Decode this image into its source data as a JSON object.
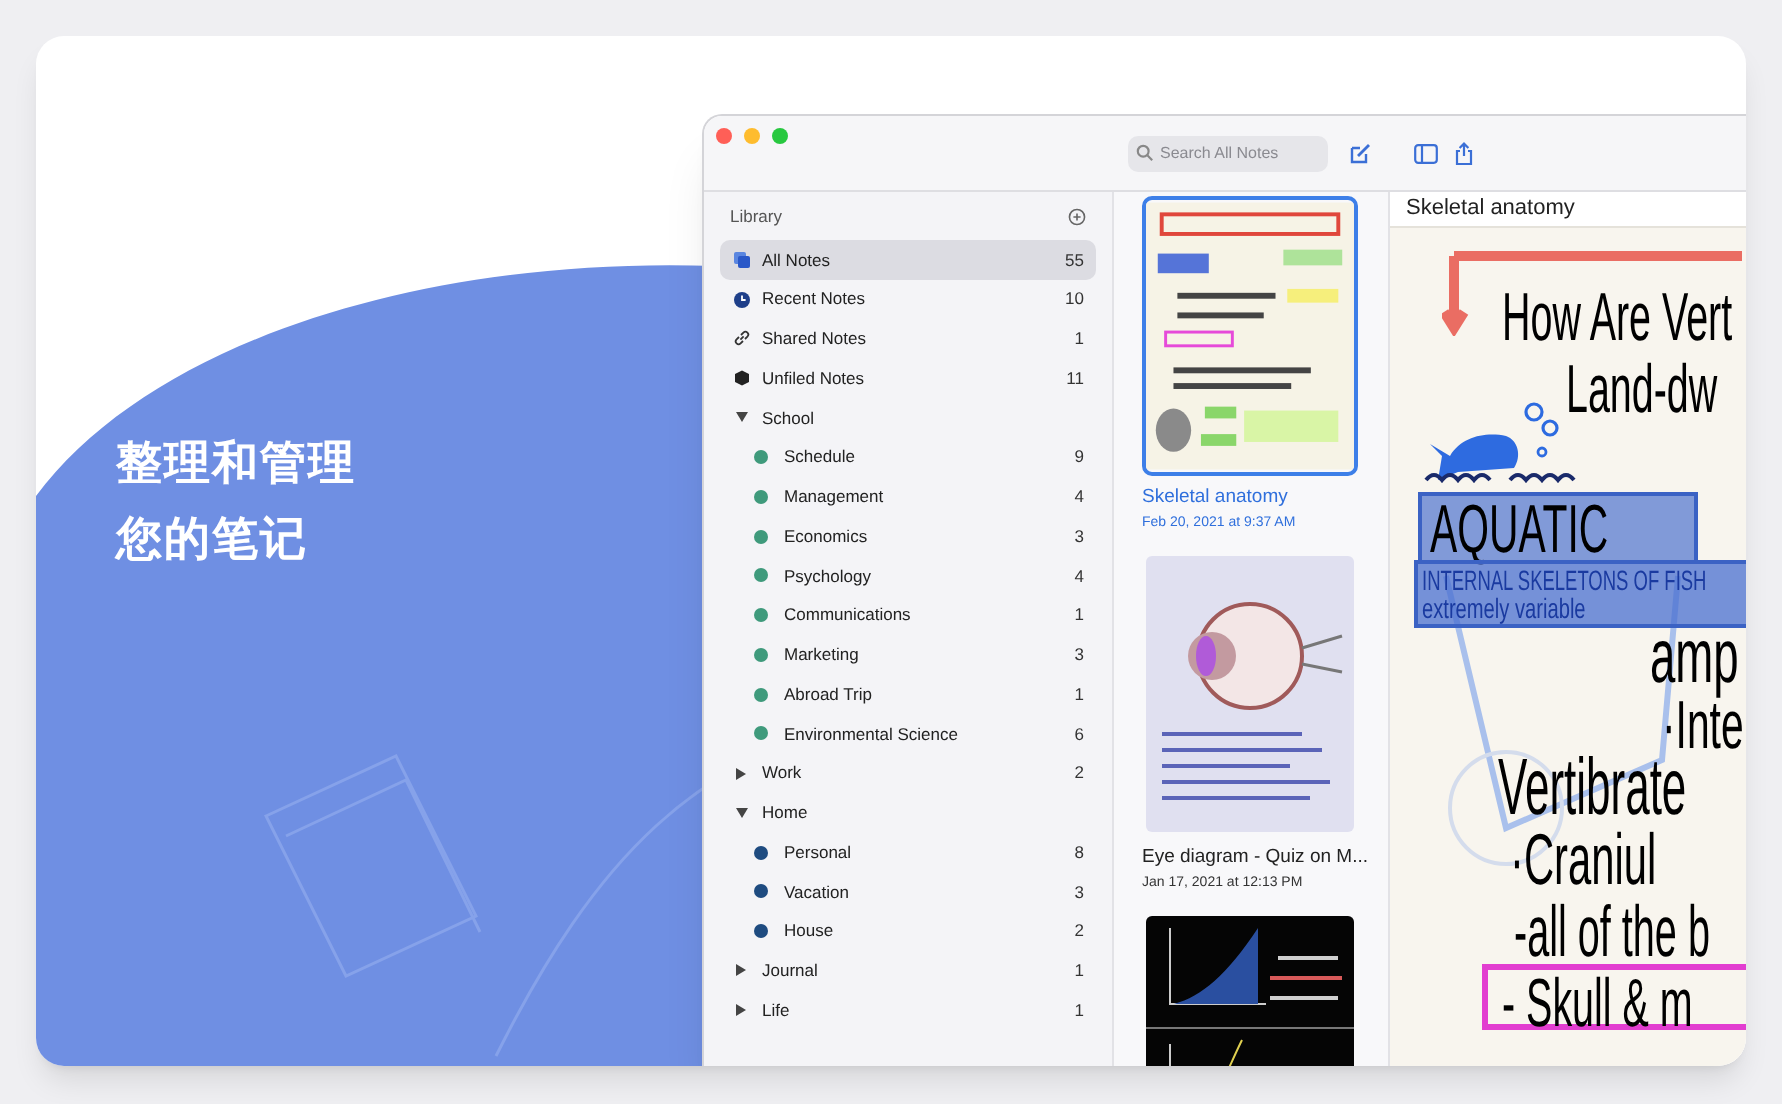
{
  "headline": [
    "整理和管理",
    "您的笔记"
  ],
  "toolbar": {
    "search": {
      "placeholder": "Search All Notes"
    }
  },
  "sidebar": {
    "header": "Library",
    "items": [
      {
        "kind": "smart",
        "label": "All Notes",
        "count": "55",
        "selected": true
      },
      {
        "kind": "smart",
        "label": "Recent Notes",
        "count": "10",
        "selected": false
      },
      {
        "kind": "smart",
        "label": "Shared Notes",
        "count": "1",
        "selected": false
      },
      {
        "kind": "smart",
        "label": "Unfiled Notes",
        "count": "11",
        "selected": false
      },
      {
        "kind": "folder",
        "label": "School",
        "expanded": true,
        "selected": false,
        "children": [
          {
            "kind": "tag",
            "label": "Schedule",
            "count": "9",
            "color": "#3f9a7c",
            "selected": false
          },
          {
            "kind": "tag",
            "label": "Management",
            "count": "4",
            "color": "#3f9a7c",
            "selected": false
          },
          {
            "kind": "tag",
            "label": "Economics",
            "count": "3",
            "color": "#3f9a7c",
            "selected": false
          },
          {
            "kind": "tag",
            "label": "Psychology",
            "count": "4",
            "color": "#3f9a7c",
            "selected": false
          },
          {
            "kind": "tag",
            "label": "Communications",
            "count": "1",
            "color": "#3f9a7c",
            "selected": false
          },
          {
            "kind": "tag",
            "label": "Marketing",
            "count": "3",
            "color": "#3f9a7c",
            "selected": false
          },
          {
            "kind": "tag",
            "label": "Abroad Trip",
            "count": "1",
            "color": "#3f9a7c",
            "selected": false
          },
          {
            "kind": "tag",
            "label": "Environmental Science",
            "count": "6",
            "color": "#3f9a7c",
            "selected": false
          }
        ]
      },
      {
        "kind": "folder",
        "label": "Work",
        "count": "2",
        "expanded": false,
        "selected": false
      },
      {
        "kind": "folder",
        "label": "Home",
        "expanded": true,
        "selected": false,
        "children": [
          {
            "kind": "tag",
            "label": "Personal",
            "count": "8",
            "color": "#1e4b80",
            "selected": false
          },
          {
            "kind": "tag",
            "label": "Vacation",
            "count": "3",
            "color": "#1e4b80",
            "selected": false
          },
          {
            "kind": "tag",
            "label": "House",
            "count": "2",
            "color": "#1e4b80",
            "selected": false
          }
        ]
      },
      {
        "kind": "folder",
        "label": "Journal",
        "count": "1",
        "expanded": false,
        "selected": false
      },
      {
        "kind": "folder",
        "label": "Life",
        "count": "1",
        "expanded": false,
        "selected": false
      }
    ]
  },
  "notes": [
    {
      "title": "Skeletal anatomy",
      "date": "Feb 20, 2021 at 9:37 AM",
      "selected": true
    },
    {
      "title": "Eye diagram - Quiz on M...",
      "date": "Jan 17, 2021 at 12:13 PM",
      "selected": false
    },
    {
      "selected": false
    }
  ],
  "editor": {
    "title": "Skeletal anatomy",
    "lines": [
      {
        "text": "How Are Vert"
      },
      {
        "text": "Land-dw"
      },
      {
        "text": "AQUATIC"
      },
      {
        "text": "INTERNAL SKELETONS OF FISH"
      },
      {
        "text": "extremely variable"
      },
      {
        "text": "amp"
      },
      {
        "text": "·Inte"
      },
      {
        "text": "Vertibrate"
      },
      {
        "text": "·Craniul"
      },
      {
        "text": "-all of the b"
      },
      {
        "text": "- Skull & m"
      }
    ]
  }
}
